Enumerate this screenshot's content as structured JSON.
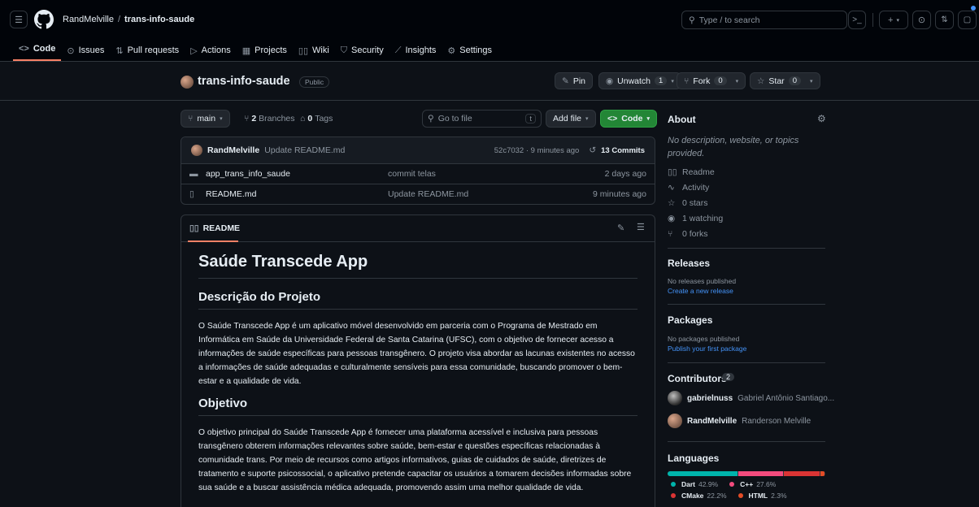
{
  "header": {
    "owner": "RandMelville",
    "separator": "/",
    "repo": "trans-info-saude",
    "search_placeholder": "Type / to search"
  },
  "nav_tabs": [
    {
      "label": "Code",
      "icon": "code-icon"
    },
    {
      "label": "Issues",
      "icon": "issue-icon"
    },
    {
      "label": "Pull requests",
      "icon": "pull-request-icon"
    },
    {
      "label": "Actions",
      "icon": "play-icon"
    },
    {
      "label": "Projects",
      "icon": "table-icon"
    },
    {
      "label": "Wiki",
      "icon": "book-icon"
    },
    {
      "label": "Security",
      "icon": "shield-icon"
    },
    {
      "label": "Insights",
      "icon": "graph-icon"
    },
    {
      "label": "Settings",
      "icon": "gear-icon"
    }
  ],
  "repo_header": {
    "name": "trans-info-saude",
    "visibility": "Public",
    "pin_label": "Pin",
    "unwatch_label": "Unwatch",
    "watch_count": "1",
    "fork_label": "Fork",
    "fork_count": "0",
    "star_label": "Star",
    "star_count": "0"
  },
  "toolbar": {
    "branch": "main",
    "branches_count": "2",
    "branches_label": "Branches",
    "tags_count": "0",
    "tags_label": "Tags",
    "goto_placeholder": "Go to file",
    "goto_shortcut": "t",
    "add_file_label": "Add file",
    "code_label": "Code"
  },
  "commit_bar": {
    "author": "RandMelville",
    "message": "Update README.md",
    "meta": "52c7032 · 9 minutes ago",
    "commits_count": "13 Commits"
  },
  "files": [
    {
      "type": "folder",
      "name": "app_trans_info_saude",
      "message": "commit telas",
      "time": "2 days ago"
    },
    {
      "type": "file",
      "name": "README.md",
      "message": "Update README.md",
      "time": "9 minutes ago"
    }
  ],
  "readme": {
    "tab_label": "README",
    "h1": "Saúde Transcede App",
    "h2_desc": "Descrição do Projeto",
    "p_desc": "O Saúde Transcede App é um aplicativo móvel desenvolvido em parceria com o Programa de Mestrado em Informática em Saúde da Universidade Federal de Santa Catarina (UFSC), com o objetivo de fornecer acesso a informações de saúde específicas para pessoas transgênero. O projeto visa abordar as lacunas existentes no acesso a informações de saúde adequadas e culturalmente sensíveis para essa comunidade, buscando promover o bem-estar e a qualidade de vida.",
    "h2_obj": "Objetivo",
    "p_obj": "O objetivo principal do Saúde Transcede App é fornecer uma plataforma acessível e inclusiva para pessoas transgênero obterem informações relevantes sobre saúde, bem-estar e questões específicas relacionadas à comunidade trans. Por meio de recursos como artigos informativos, guias de cuidados de saúde, diretrizes de tratamento e suporte psicossocial, o aplicativo pretende capacitar os usuários a tomarem decisões informadas sobre sua saúde e a buscar assistência médica adequada, promovendo assim uma melhor qualidade de vida."
  },
  "about": {
    "title": "About",
    "description": "No description, website, or topics provided.",
    "items": [
      {
        "icon": "book-icon",
        "label": "Readme"
      },
      {
        "icon": "activity-icon",
        "label": "Activity"
      },
      {
        "icon": "star-icon",
        "label": "0 stars"
      },
      {
        "icon": "eye-icon",
        "label": "1 watching"
      },
      {
        "icon": "fork-icon",
        "label": "0 forks"
      }
    ]
  },
  "releases": {
    "title": "Releases",
    "empty": "No releases published",
    "link": "Create a new release"
  },
  "packages": {
    "title": "Packages",
    "empty": "No packages published",
    "link": "Publish your first package"
  },
  "contributors": {
    "title": "Contributors",
    "count": "2",
    "list": [
      {
        "login": "gabrielnuss",
        "name": "Gabriel Antônio Santiago..."
      },
      {
        "login": "RandMelville",
        "name": "Randerson Melville"
      }
    ]
  },
  "languages": {
    "title": "Languages",
    "list": [
      {
        "name": "Dart",
        "percent": 42.9,
        "label": "42.9%",
        "color": "#00b4ab"
      },
      {
        "name": "C++",
        "percent": 27.6,
        "label": "27.6%",
        "color": "#f34b7d"
      },
      {
        "name": "CMake",
        "percent": 22.2,
        "label": "22.2%",
        "color": "#da3434"
      },
      {
        "name": "HTML",
        "percent": 2.3,
        "label": "2.3%",
        "color": "#e34c26"
      }
    ]
  },
  "colors": {
    "accent_green": "#238636",
    "link_blue": "#4493f8",
    "tab_underline": "#f78166"
  }
}
